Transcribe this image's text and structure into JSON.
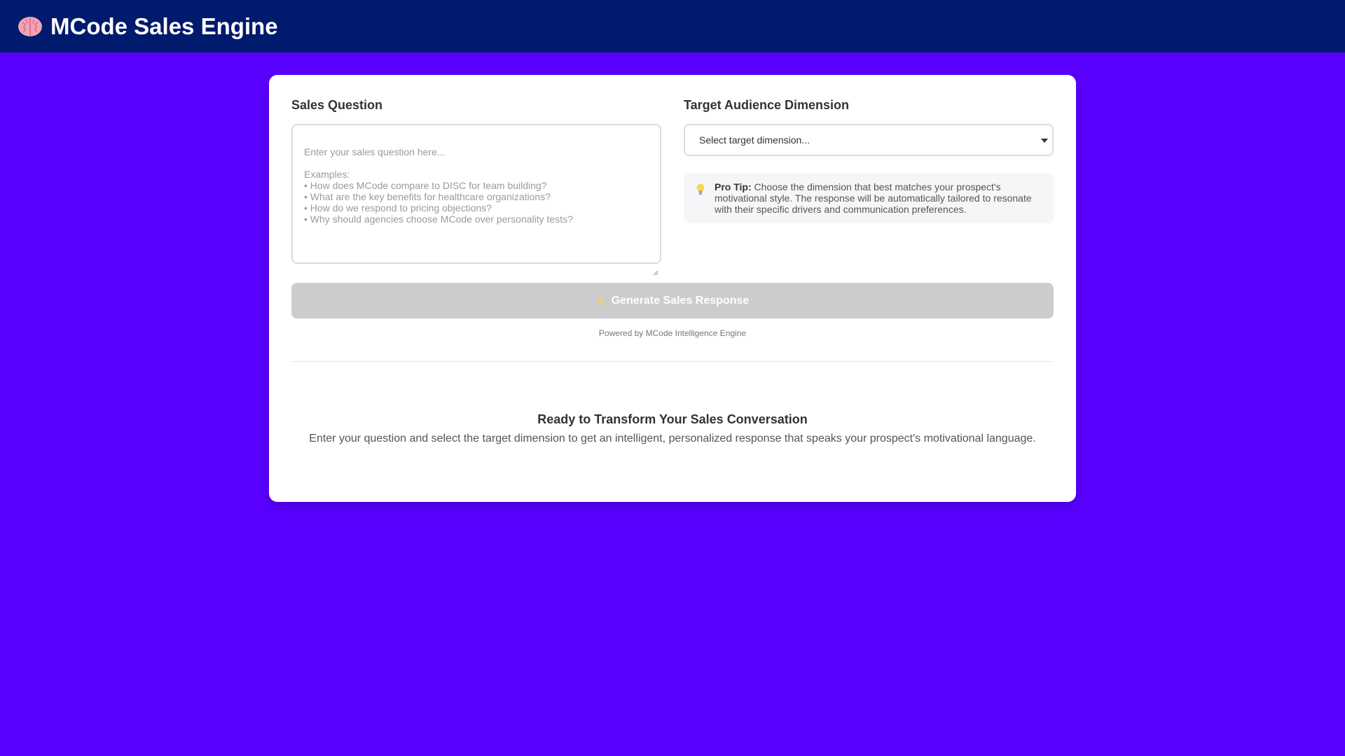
{
  "header": {
    "title": "MCode Sales Engine",
    "icon": "brain-icon",
    "background": "#001a6e"
  },
  "page": {
    "background": "#5a00ff"
  },
  "form": {
    "question_label": "Sales Question",
    "question_placeholder": "Enter your sales question here...\n\nExamples:\n• How does MCode compare to DISC for team building?\n• What are the key benefits for healthcare organizations?\n• How do we respond to pricing objections?\n• Why should agencies choose MCode over personality tests?",
    "dimension_label": "Target Audience Dimension",
    "dimension_selected": "Select target dimension...",
    "tip_title": "Pro Tip:",
    "tip_text": " Choose the dimension that best matches your prospect's motivational style. The response will be automatically tailored to resonate with their specific drivers and communication preferences.",
    "tip_icon": "lightbulb-icon",
    "generate_label": "Generate Sales Response",
    "generate_icon": "sparkle-icon",
    "generate_state": "disabled",
    "powered_by": "Powered by MCode Intelligence Engine"
  },
  "empty_state": {
    "title": "Ready to Transform Your Sales Conversation",
    "description": "Enter your question and select the target dimension to get an intelligent, personalized response that speaks your prospect's motivational language."
  }
}
